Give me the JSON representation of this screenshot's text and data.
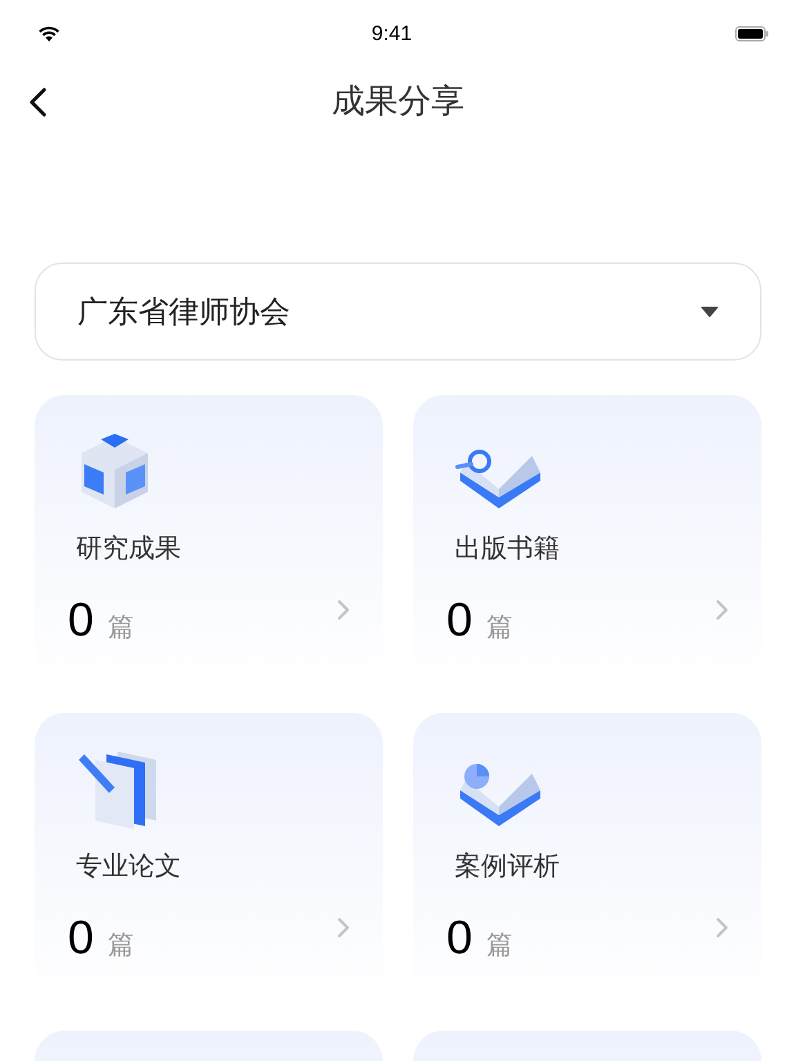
{
  "status_bar": {
    "time": "9:41"
  },
  "nav": {
    "title": "成果分享"
  },
  "org_select": {
    "value": "广东省律师协会"
  },
  "cards": [
    {
      "kind": "full",
      "title": "研究成果",
      "count": "0",
      "unit": "篇"
    },
    {
      "kind": "full",
      "title": "出版书籍",
      "count": "0",
      "unit": "篇"
    },
    {
      "kind": "full",
      "title": "专业论文",
      "count": "0",
      "unit": "篇"
    },
    {
      "kind": "full",
      "title": "案例评析",
      "count": "0",
      "unit": "篇"
    },
    {
      "kind": "partial"
    },
    {
      "kind": "partial"
    }
  ]
}
